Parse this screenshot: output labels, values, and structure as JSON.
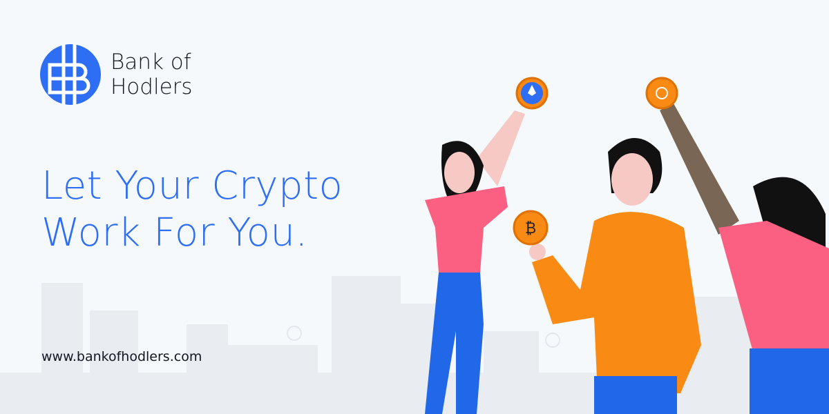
{
  "brand": {
    "name_line1": "Bank of",
    "name_line2": "Hodlers",
    "logo_letter": "B"
  },
  "headline": {
    "line1": "Let Your Crypto",
    "line2": "Work For You."
  },
  "website": "www.bankofhodlers.com",
  "colors": {
    "brand_blue": "#2d6ef5",
    "text_dark": "#15151f",
    "background": "#f5f9fc",
    "orange": "#f98a14",
    "pink": "#fb5f82",
    "jeans": "#2168e8"
  }
}
